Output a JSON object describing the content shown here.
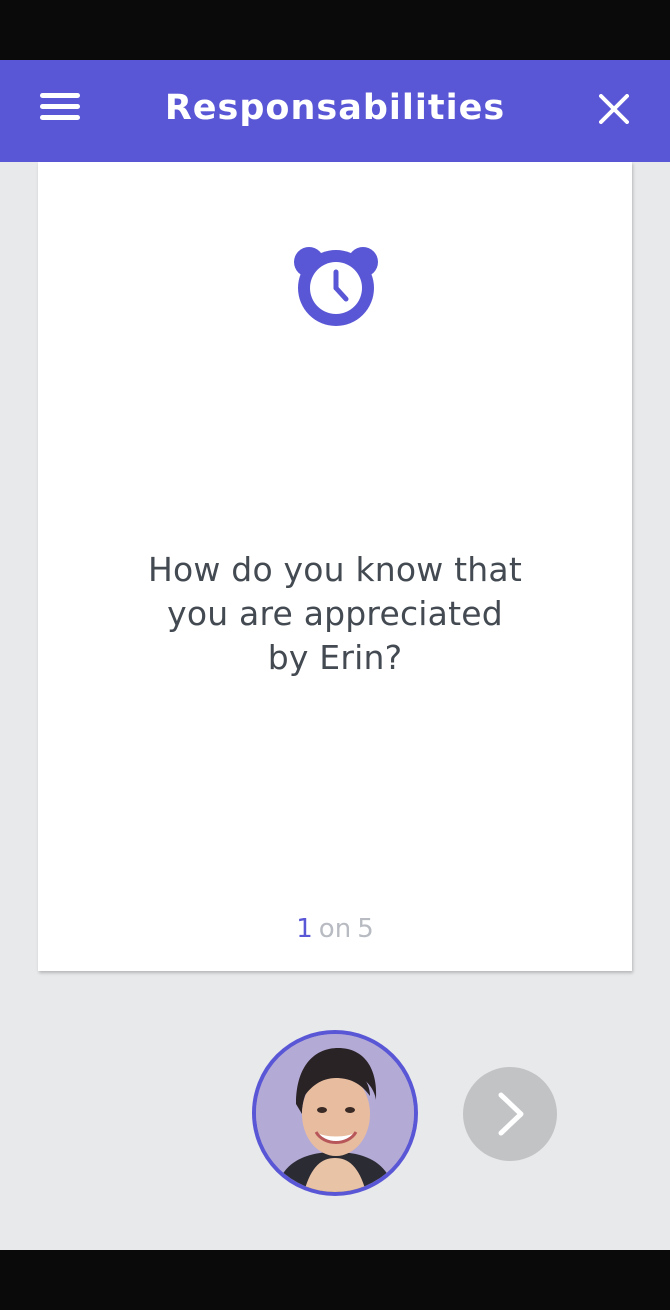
{
  "app_bar": {
    "title": "Responsabilities",
    "menu_icon": "hamburger-menu-icon",
    "close_icon": "close-icon"
  },
  "card": {
    "category_icon": "alarm-clock-icon",
    "question_lines": [
      "How do you know that",
      "you are appreciated",
      "by Erin?"
    ],
    "pagination": {
      "current": "1",
      "separator": "on",
      "total": "5"
    }
  },
  "footer": {
    "avatar_alt": "Erin",
    "next_icon": "chevron-right-icon"
  },
  "colors": {
    "accent": "#5a57d6",
    "background": "#e8e9eb",
    "next_button": "#c1c3c5",
    "text": "#444a52",
    "muted_text": "#b8bcc2"
  }
}
